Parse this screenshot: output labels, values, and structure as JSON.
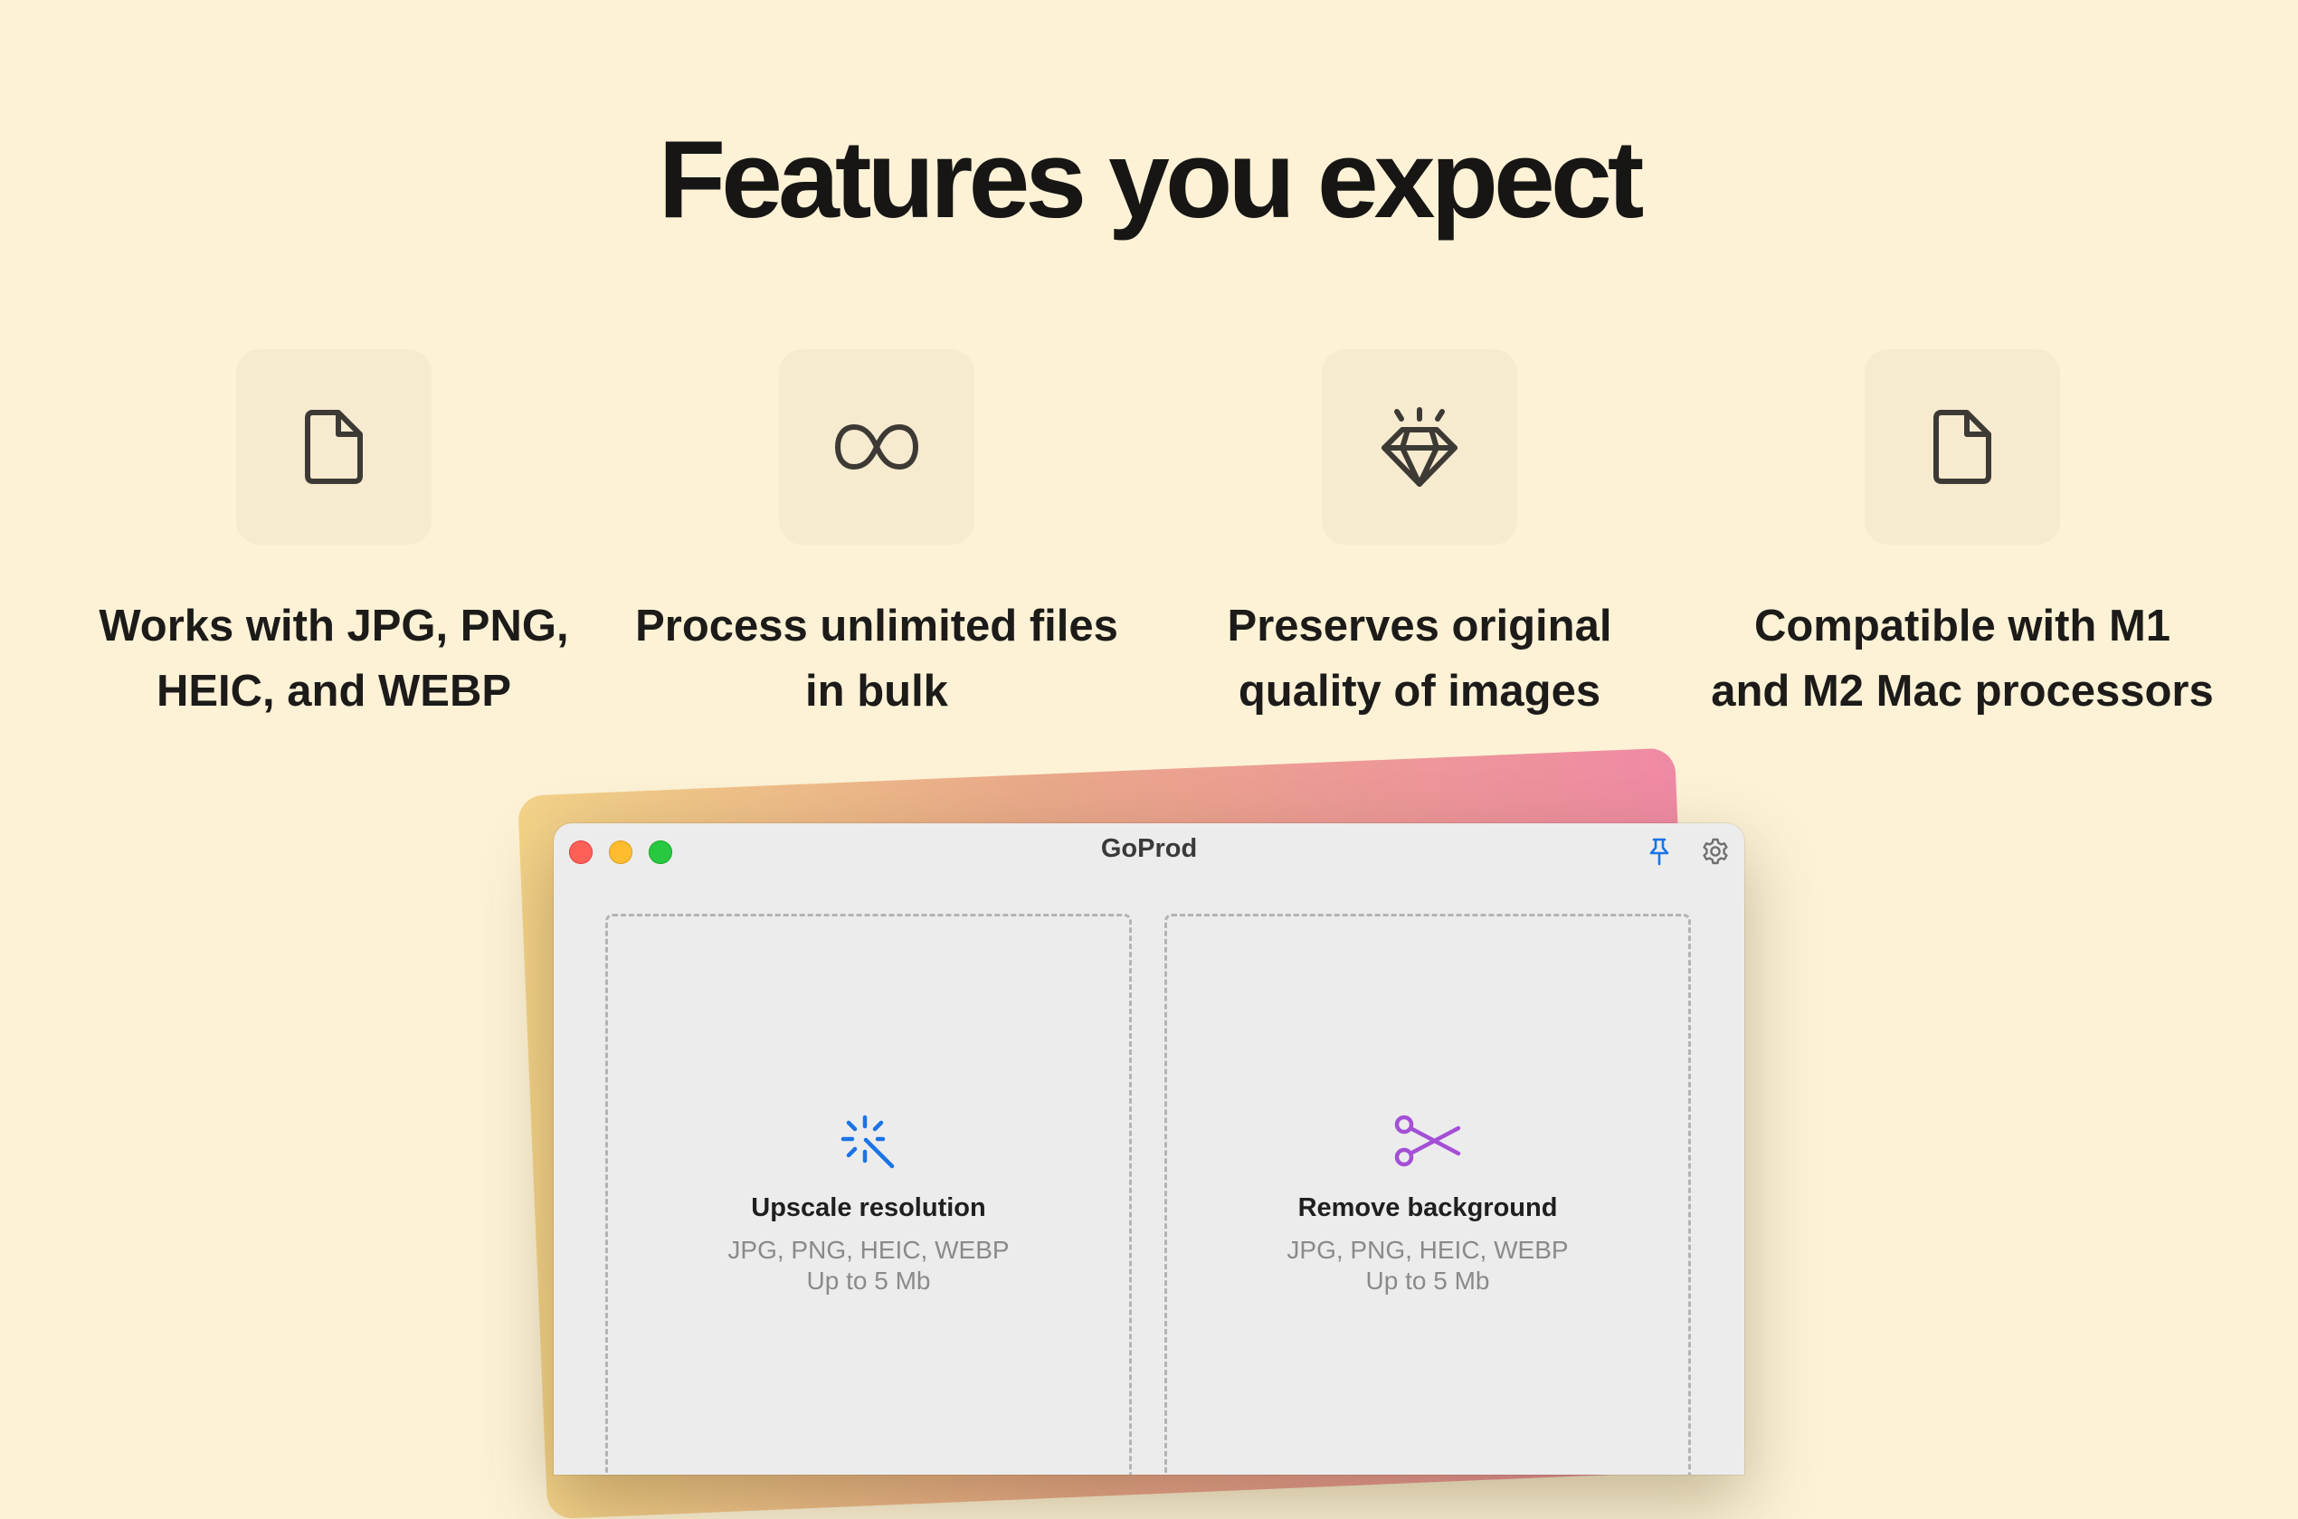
{
  "page": {
    "heading": "Features you expect"
  },
  "features": [
    {
      "icon": "document-icon",
      "lines": [
        "Works with JPG, PNG,",
        "HEIC, and WEBP"
      ]
    },
    {
      "icon": "infinity-icon",
      "lines": [
        "Process unlimited files",
        "in bulk"
      ]
    },
    {
      "icon": "diamond-icon",
      "lines": [
        "Preserves original",
        "quality of images"
      ]
    },
    {
      "icon": "document-icon",
      "lines": [
        "Compatible with M1",
        "and M2 Mac processors"
      ]
    }
  ],
  "app_window": {
    "title": "GoProd",
    "titlebar_icons": [
      "pin-icon",
      "gear-icon"
    ],
    "drop_zones": [
      {
        "icon": "magic-wand-icon",
        "icon_color": "#1a73e8",
        "title": "Upscale resolution",
        "formats": "JPG, PNG, HEIC, WEBP",
        "limit": "Up to 5 Mb"
      },
      {
        "icon": "scissors-icon",
        "icon_color": "#a44fd6",
        "title": "Remove background",
        "formats": "JPG, PNG, HEIC, WEBP",
        "limit": "Up to 5 Mb"
      }
    ]
  },
  "colors": {
    "background": "#fdf2d6",
    "icon_tile": "#f6ebcf",
    "accent_blue": "#1a73e8",
    "accent_purple": "#a44fd6"
  }
}
